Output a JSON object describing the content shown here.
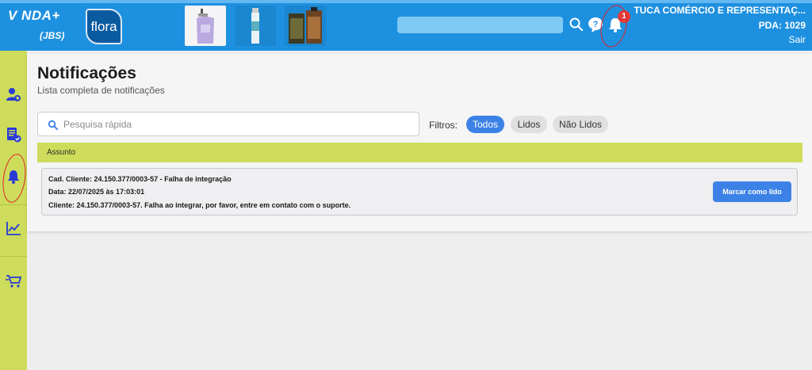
{
  "header": {
    "logo_brand": "V NDA+",
    "logo_sub": "(JBS)",
    "logo_flora": "flora",
    "notification_count": "1",
    "company": "TUCA COMÉRCIO E REPRESENTAÇ...",
    "pda": "PDA: 1029",
    "logout": "Sair",
    "icons": [
      "search-icon",
      "help-icon",
      "bell-icon"
    ]
  },
  "sidebar": {
    "items": [
      {
        "name": "sidebar-item-clients",
        "icon": "user-gear-icon"
      },
      {
        "name": "sidebar-item-orders",
        "icon": "document-check-icon"
      },
      {
        "name": "sidebar-item-notifications",
        "icon": "bell-icon"
      },
      {
        "name": "sidebar-item-reports",
        "icon": "chart-line-icon"
      },
      {
        "name": "sidebar-item-cart",
        "icon": "cart-icon"
      }
    ]
  },
  "page": {
    "title": "Notificações",
    "subtitle": "Lista completa de notificações"
  },
  "search": {
    "placeholder": "Pesquisa rápida",
    "value": ""
  },
  "filters": {
    "label": "Filtros:",
    "options": [
      "Todos",
      "Lidos",
      "Não Lidos"
    ],
    "selected": "Todos"
  },
  "table": {
    "header": "Assunto",
    "rows": [
      {
        "title": "Cad. Cliente: 24.150.377/0003-57 - Falha de integração",
        "date": "Data: 22/07/2025 às 17:03:01",
        "message": "Cliente: 24.150.377/0003-57. Falha ao integrar, por favor, entre em contato com o suporte.",
        "action": "Marcar como lido"
      }
    ]
  },
  "colors": {
    "header_bg": "#1e90e0",
    "accent_green": "#cddc5a",
    "button_blue": "#3c82e6",
    "badge_red": "#e53935",
    "sidebar_icon": "#2a3bd6"
  }
}
